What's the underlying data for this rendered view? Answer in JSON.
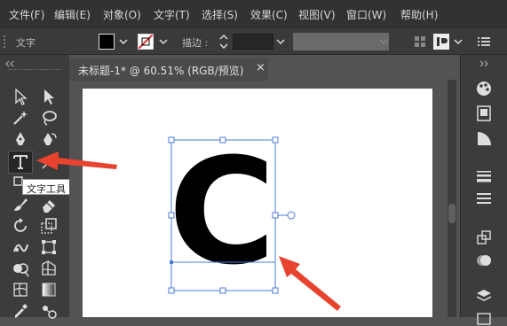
{
  "menu": {
    "items": [
      "文件(F)",
      "编辑(E)",
      "对象(O)",
      "文字(T)",
      "选择(S)",
      "效果(C)",
      "视图(V)",
      "窗口(W)",
      "帮助(H)"
    ]
  },
  "control_bar": {
    "tool_label": "文字",
    "stroke_label": "描边 :"
  },
  "document": {
    "tab_title": "未标题-1* @ 60.51% (RGB/预览)",
    "tab_close": "×"
  },
  "artwork": {
    "letter": "C"
  },
  "tooltip": {
    "text": "文字工具 (T)"
  },
  "colors": {
    "menubar_bg": "#323232",
    "panel_bg": "#3c3c3c",
    "canvas_bg": "#535353",
    "selection": "#4a7bd8",
    "arrow": "#e8432f"
  },
  "icons": {
    "left_tools": [
      "selection-icon",
      "direct-selection-icon",
      "magic-wand-icon",
      "lasso-icon",
      "pen-icon",
      "curvature-icon",
      "type-icon",
      "line-icon",
      "paintbrush-icon",
      "eraser-icon",
      "rotate-icon",
      "scale-icon",
      "warp-icon",
      "free-transform-icon",
      "shape-builder-icon",
      "perspective-icon",
      "mesh-icon",
      "gradient-icon",
      "eyedropper-icon",
      "blend-icon"
    ],
    "right_panels": [
      "color-panel-icon",
      "libraries-icon",
      "color-guide-icon",
      "stroke-panel-icon",
      "align-panel-icon",
      "transform-panel-icon",
      "pathfinder-icon",
      "layers-icon"
    ]
  }
}
